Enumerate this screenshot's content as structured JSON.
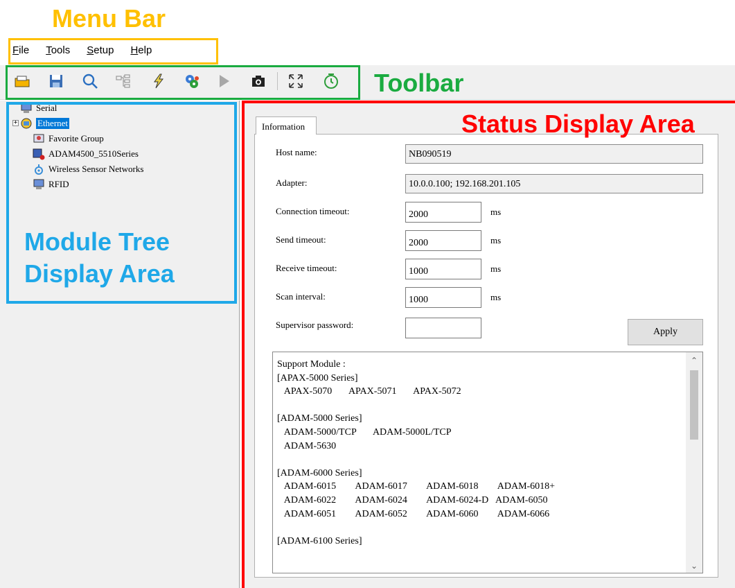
{
  "annotations": {
    "menu_bar": "Menu Bar",
    "toolbar": "Toolbar",
    "module_tree_line1": "Module Tree",
    "module_tree_line2": "Display Area",
    "status_display": "Status Display Area",
    "colors": {
      "menu_bar": "#FFC000",
      "toolbar": "#1AAB40",
      "module_tree": "#1FA8E8",
      "status_display": "#FF0000"
    }
  },
  "menu": {
    "items": [
      "File",
      "Tools",
      "Setup",
      "Help"
    ]
  },
  "toolbar": {
    "icons": [
      "open-folder-icon",
      "save-icon",
      "search-icon",
      "network-tree-icon",
      "lightning-icon",
      "gears-icon",
      "play-icon",
      "camera-icon",
      "fullscreen-icon",
      "refresh-timer-icon"
    ]
  },
  "tree": {
    "items": [
      {
        "label": "Serial",
        "icon": "serial-computer-icon"
      },
      {
        "label": "Ethernet",
        "icon": "ethernet-icon",
        "selected": true,
        "expandable": true
      },
      {
        "label": "Favorite Group",
        "icon": "favorite-group-icon"
      },
      {
        "label": "ADAM4500_5510Series",
        "icon": "adam-module-icon"
      },
      {
        "label": "Wireless Sensor Networks",
        "icon": "wireless-network-icon"
      },
      {
        "label": "RFID",
        "icon": "rfid-computer-icon"
      }
    ]
  },
  "status": {
    "tab_label": "Information",
    "host_name": {
      "label": "Host name:",
      "value": "NB090519"
    },
    "adapter": {
      "label": "Adapter:",
      "value": "10.0.0.100; 192.168.201.105"
    },
    "connection_timeout": {
      "label": "Connection timeout:",
      "value": "2000",
      "unit": "ms"
    },
    "send_timeout": {
      "label": "Send timeout:",
      "value": "2000",
      "unit": "ms"
    },
    "receive_timeout": {
      "label": "Receive timeout:",
      "value": "1000",
      "unit": "ms"
    },
    "scan_interval": {
      "label": "Scan interval:",
      "value": "1000",
      "unit": "ms"
    },
    "supervisor_password": {
      "label": "Supervisor password:",
      "value": ""
    },
    "apply_label": "Apply",
    "support_module_text": "Support Module :\n[APAX-5000 Series]\n   APAX-5070       APAX-5071       APAX-5072\n\n[ADAM-5000 Series]\n   ADAM-5000/TCP       ADAM-5000L/TCP\n   ADAM-5630\n\n[ADAM-6000 Series]\n   ADAM-6015        ADAM-6017        ADAM-6018        ADAM-6018+\n   ADAM-6022        ADAM-6024        ADAM-6024-D   ADAM-6050\n   ADAM-6051        ADAM-6052        ADAM-6060        ADAM-6066\n\n[ADAM-6100 Series]"
  }
}
